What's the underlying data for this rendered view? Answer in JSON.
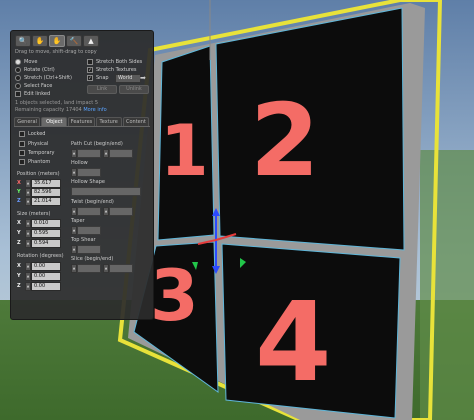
{
  "tools": [
    {
      "name": "focus",
      "glyph": "🔍"
    },
    {
      "name": "move",
      "glyph": "✋"
    },
    {
      "name": "edit",
      "glyph": "✋"
    },
    {
      "name": "create",
      "glyph": "🔨"
    },
    {
      "name": "land",
      "glyph": "▲"
    }
  ],
  "hint": "Drag to move, shift-drag to copy",
  "modes": {
    "move": "Move",
    "rotate": "Rotate (Ctrl)",
    "stretch": "Stretch (Ctrl+Shift)",
    "select_face": "Select Face",
    "edit_linked": "Edit linked"
  },
  "options": {
    "stretch_both": "Stretch Both Sides",
    "stretch_textures": "Stretch Textures",
    "snap": "Snap",
    "snap_mode": "World"
  },
  "buttons": {
    "link": "Link",
    "unlink": "Unlink"
  },
  "status": {
    "line1": "1 objects selected, land impact 5",
    "line2": "Remaining capacity 17404",
    "more_info": "More info"
  },
  "tabs": [
    "General",
    "Object",
    "Features",
    "Texture",
    "Content"
  ],
  "active_tab": 1,
  "object": {
    "locked": "Locked",
    "physical": "Physical",
    "temporary": "Temporary",
    "phantom": "Phantom",
    "position_label": "Position (meters)",
    "position": {
      "x": "35.617",
      "y": "82.596",
      "z": "21.014"
    },
    "size_label": "Size (meters)",
    "size": {
      "x": "0.010",
      "y": "0.595",
      "z": "0.594"
    },
    "rotation_label": "Rotation (degrees)",
    "rotation": {
      "x": "0.00",
      "y": "0.00",
      "z": "0.00"
    },
    "path_cut": "Path Cut (begin/end)",
    "hollow": "Hollow",
    "hollow_shape": "Hollow Shape",
    "twist": "Twist (begin/end)",
    "taper": "Taper",
    "top_shear": "Top Shear",
    "slice": "Slice (begin/end)",
    "axis_x": "X",
    "axis_y": "Y",
    "axis_z": "Z"
  },
  "scene": {
    "tiles": [
      "1",
      "2",
      "3",
      "4"
    ]
  }
}
